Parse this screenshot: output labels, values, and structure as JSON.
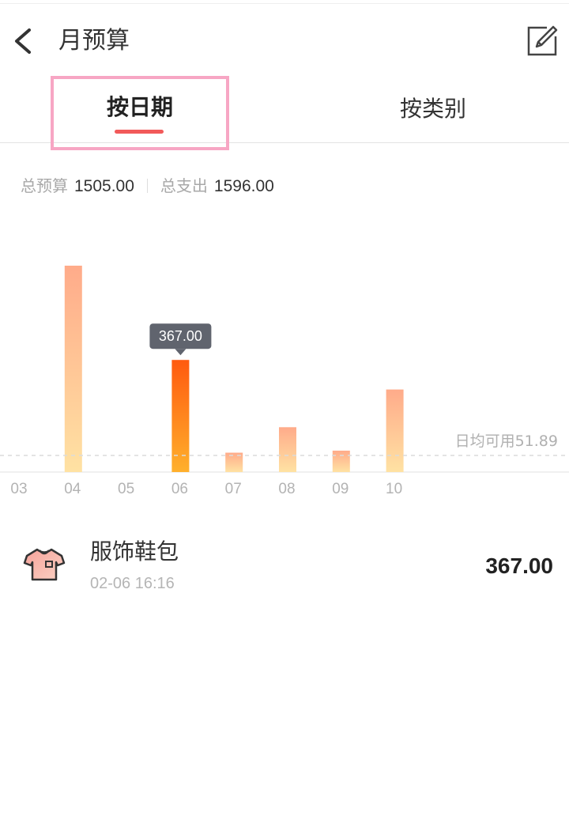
{
  "header": {
    "title": "月预算",
    "back_icon": "chevron-left-icon",
    "edit_icon": "edit-icon"
  },
  "tabs": [
    {
      "label": "按日期",
      "active": true
    },
    {
      "label": "按类别",
      "active": false
    }
  ],
  "summary": {
    "budget_label": "总预算",
    "budget_value": "1505.00",
    "spend_label": "总支出",
    "spend_value": "1596.00"
  },
  "chart_data": {
    "type": "bar",
    "categories": [
      "03",
      "04",
      "05",
      "06",
      "07",
      "08",
      "09",
      "10"
    ],
    "values": [
      0,
      405,
      0,
      220,
      38,
      88,
      42,
      162
    ],
    "ylim": [
      0,
      450
    ],
    "selected_index": 3,
    "tooltip": "367.00",
    "average_label": "日均可用51.89",
    "average_value": 51.89,
    "colors": {
      "bar_top": "#ffab8a",
      "bar_bottom": "#ffe2a3",
      "selected_top": "#ff5a0f",
      "selected_bottom": "#ffb02c",
      "tooltip_bg": "#60646e"
    }
  },
  "records": [
    {
      "name": "服饰鞋包",
      "time": "02-06 16:16",
      "amount": "367.00",
      "icon": "tshirt-icon"
    }
  ],
  "colors": {
    "accent": "#f25a5a",
    "highlight_box": "#f7a6c4"
  }
}
